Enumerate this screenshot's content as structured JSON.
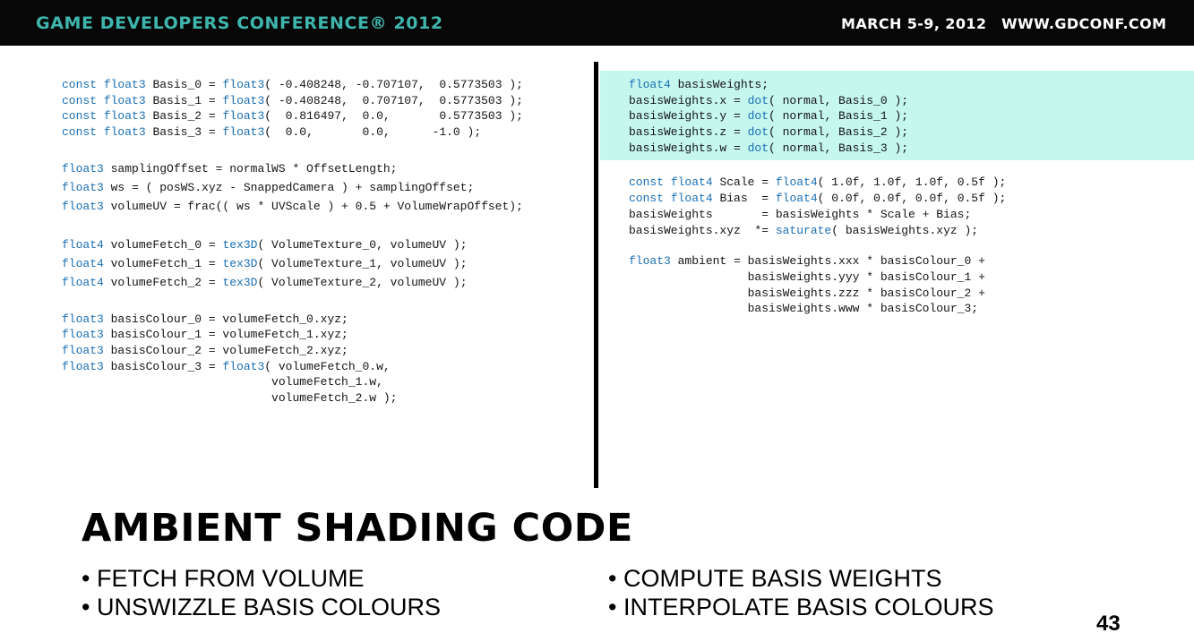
{
  "header": {
    "conference": "GAME DEVELOPERS CONFERENCE® 2012",
    "dates": "MARCH 5-9, 2012",
    "url": "WWW.GDCONF.COM"
  },
  "code_left": {
    "basis_0": "const float3 Basis_0 = float3( -0.408248, -0.707107,  0.5773503 );",
    "basis_1": "const float3 Basis_1 = float3( -0.408248,  0.707107,  0.5773503 );",
    "basis_2": "const float3 Basis_2 = float3(  0.816497,  0.0,       0.5773503 );",
    "basis_3": "const float3 Basis_3 = float3(  0.0,       0.0,      -1.0 );",
    "sampling_offset": "float3 samplingOffset = normalWS * OffsetLength;",
    "ws": "float3 ws = ( posWS.xyz - SnappedCamera ) + samplingOffset;",
    "volume_uv": "float3 volumeUV = frac(( ws * UVScale ) + 0.5 + VolumeWrapOffset);",
    "fetch_0": "float4 volumeFetch_0 = tex3D( VolumeTexture_0, volumeUV );",
    "fetch_1": "float4 volumeFetch_1 = tex3D( VolumeTexture_1, volumeUV );",
    "fetch_2": "float4 volumeFetch_2 = tex3D( VolumeTexture_2, volumeUV );",
    "colour_0": "float3 basisColour_0 = volumeFetch_0.xyz;",
    "colour_1": "float3 basisColour_1 = volumeFetch_1.xyz;",
    "colour_2": "float3 basisColour_2 = volumeFetch_2.xyz;",
    "colour_3": "float3 basisColour_3 = float3( volumeFetch_0.w,",
    "colour_3_cont_1": "                              volumeFetch_1.w,",
    "colour_3_cont_2": "                              volumeFetch_2.w );"
  },
  "code_right": {
    "decl": "float4 basisWeights;",
    "weight_x": "basisWeights.x = dot( normal, Basis_0 );",
    "weight_y": "basisWeights.y = dot( normal, Basis_1 );",
    "weight_z": "basisWeights.z = dot( normal, Basis_2 );",
    "weight_w": "basisWeights.w = dot( normal, Basis_3 );",
    "scale": "const float4 Scale = float4( 1.0f, 1.0f, 1.0f, 0.5f );",
    "bias": "const float4 Bias  = float4( 0.0f, 0.0f, 0.0f, 0.5f );",
    "scale_bias": "basisWeights       = basisWeights * Scale + Bias;",
    "saturate": "basisWeights.xyz  *= saturate( basisWeights.xyz );",
    "ambient_0": "float3 ambient = basisWeights.xxx * basisColour_0 +",
    "ambient_1": "                 basisWeights.yyy * basisColour_1 +",
    "ambient_2": "                 basisWeights.zzz * basisColour_2 +",
    "ambient_3": "                 basisWeights.www * basisColour_3;"
  },
  "slide": {
    "title": "AMBIENT SHADING CODE",
    "bullets_left": [
      "• FETCH FROM VOLUME",
      "• UNSWIZZLE BASIS COLOURS"
    ],
    "bullets_right": [
      "• COMPUTE BASIS WEIGHTS",
      "• INTERPOLATE BASIS COLOURS"
    ],
    "page_number": "43"
  },
  "colors": {
    "header_background": "#070707",
    "conference_accent": "#3fb6ad",
    "code_keyword": "#1a6fb4",
    "code_text": "#141414",
    "highlight": "#c5f7ef"
  }
}
